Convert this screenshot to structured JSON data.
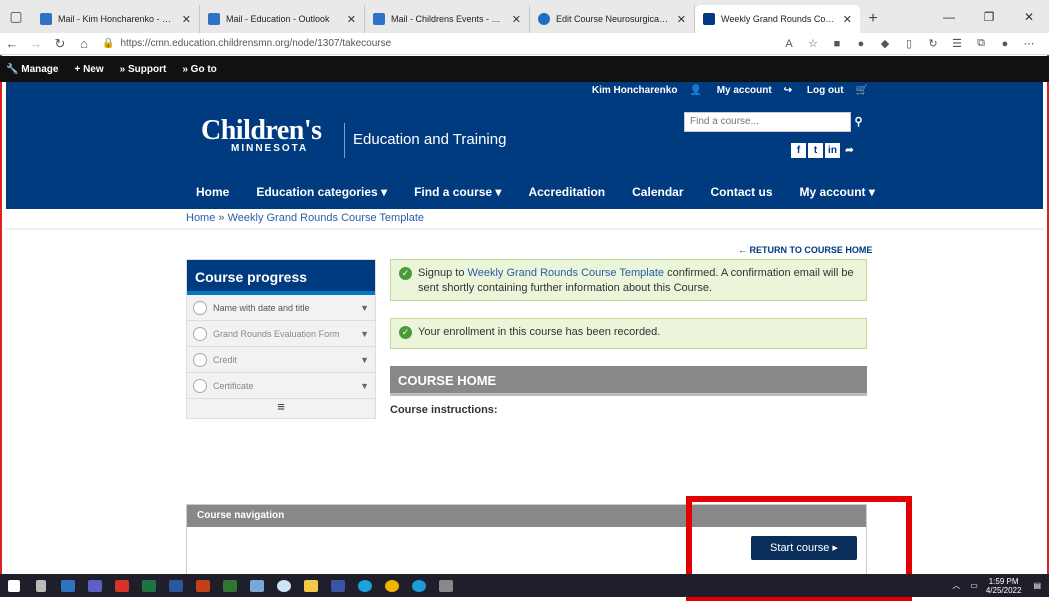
{
  "browser": {
    "tabs": [
      {
        "title": "Mail - Kim Honcharenko - Outlo",
        "color": "#2f72c4"
      },
      {
        "title": "Mail - Education - Outlook",
        "color": "#2f72c4"
      },
      {
        "title": "Mail - Childrens Events - Outlo",
        "color": "#2f72c4"
      },
      {
        "title": "Edit Course Neurosurgical Interv",
        "color": "#1b6ec2"
      },
      {
        "title": "Weekly Grand Rounds Course Te",
        "color": "#003b7f"
      }
    ],
    "url": "https://cmn.education.childrensmn.org/node/1307/takecourse"
  },
  "admin": {
    "manage": "Manage",
    "new": "+ New",
    "support": "» Support",
    "goto": "» Go to"
  },
  "header": {
    "user": "Kim Honcharenko",
    "my_account": "My account",
    "logout": "Log out",
    "logo": "Children's",
    "logo_sub": "MINNESOTA",
    "tagline": "Education and Training",
    "search_placeholder": "Find a course...",
    "nav": [
      "Home",
      "Education categories ▾",
      "Find a course ▾",
      "Accreditation",
      "Calendar",
      "Contact us",
      "My account ▾"
    ]
  },
  "breadcrumb": {
    "home": "Home",
    "sep": " » ",
    "current": "Weekly Grand Rounds Course Template"
  },
  "return_link": "← RETURN TO COURSE HOME",
  "progress": {
    "title": "Course progress",
    "items": [
      "Name with date and title",
      "Grand Rounds Evaluation Form",
      "Credit",
      "Certificate"
    ]
  },
  "messages": {
    "m1_pre": "Signup to ",
    "m1_link": "Weekly Grand Rounds Course Template",
    "m1_post": " confirmed. A confirmation email will be sent shortly containing further information about this Course.",
    "m2": "Your enrollment in this course has been recorded."
  },
  "course_home": {
    "title": "COURSE HOME",
    "instructions": "Course instructions:"
  },
  "course_nav": {
    "title": "Course navigation",
    "start": "Start course ▸"
  },
  "taskbar": {
    "time": "1:59 PM",
    "date": "4/25/2022"
  }
}
